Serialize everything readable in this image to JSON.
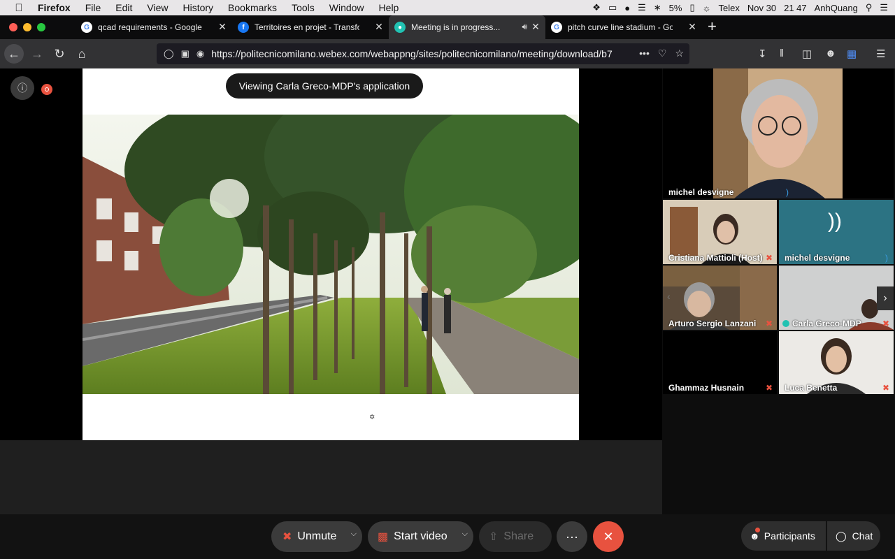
{
  "menubar": {
    "app": "Firefox",
    "items": [
      "File",
      "Edit",
      "View",
      "History",
      "Bookmarks",
      "Tools",
      "Window",
      "Help"
    ],
    "battery": "5%",
    "input_source": "Telex",
    "date": "Nov 30",
    "time": "21 47",
    "user": "AnhQuang"
  },
  "tabs": [
    {
      "title": "qcad requirements - Google Se",
      "favicon": "google-icon"
    },
    {
      "title": "Territoires en projet - Transform",
      "favicon": "facebook-icon"
    },
    {
      "title": "Meeting is in progress...",
      "favicon": "webex-icon",
      "active": true
    },
    {
      "title": "pitch curve line stadium - Goog",
      "favicon": "google-icon"
    }
  ],
  "url": "https://politecnicomilano.webex.com/webappng/sites/politecnicomilano/meeting/download/b7",
  "url_more": "•••",
  "meeting": {
    "viewing_label": "Viewing Carla Greco-MDP's application"
  },
  "participants": [
    {
      "name": "michel desvigne",
      "muted": false,
      "speaking": true
    },
    {
      "name": "Cristiana Mattioli (Host)",
      "muted": true
    },
    {
      "name": "michel desvigne",
      "muted": false,
      "speaking": true,
      "audio_only": true
    },
    {
      "name": "Arturo Sergio Lanzani",
      "muted": true
    },
    {
      "name": "Carla Greco-MDP",
      "muted": true,
      "sharing": true
    },
    {
      "name": "Ghammaz Husnain",
      "muted": true
    },
    {
      "name": "Luca Benetta",
      "muted": true
    }
  ],
  "controls": {
    "unmute": "Unmute",
    "start_video": "Start video",
    "share": "Share",
    "more": "···",
    "participants": "Participants",
    "chat": "Chat"
  },
  "colors": {
    "end_call": "#e8523f",
    "mute_red": "#e8523f",
    "speaker_blue": "#3aa0e8"
  }
}
